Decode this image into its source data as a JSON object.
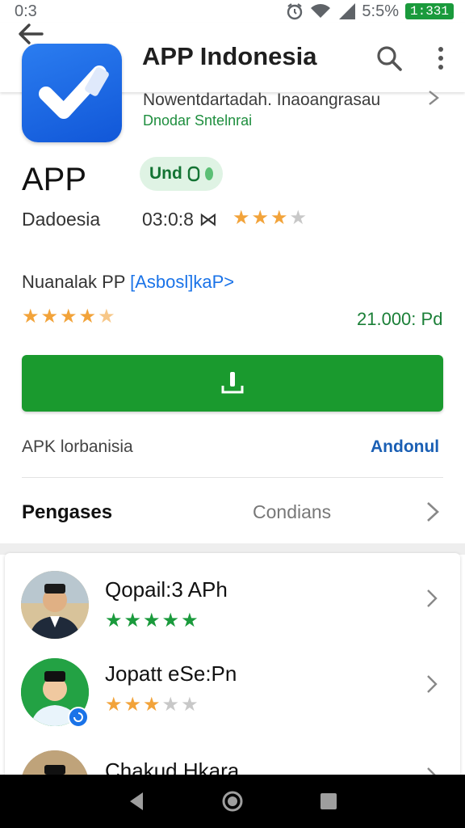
{
  "status_bar": {
    "time": "0:3",
    "battery_percent": "5:5%",
    "battery_badge": "1:331",
    "icons": [
      "alarm-icon",
      "wifi-icon",
      "signal-icon"
    ]
  },
  "header": {
    "title": "APP Indonesia",
    "back_icon": "back-arrow-icon",
    "search_icon": "search-icon",
    "more_icon": "more-vert-icon"
  },
  "app": {
    "developer_line": "Nowentdartadah. Inaoangrasau",
    "developer_sub": "Dnodar Sntelnrai",
    "name": "APP",
    "badge": "Und",
    "category": "Dadoesia",
    "meta_code": "03:0:8 ⋈",
    "meta_rating": 3,
    "about_text": "Nuanalak PP",
    "about_link": "[Asbosl]kaP>",
    "rating": 4.5,
    "price": "21.000: Pd",
    "apk_label": "APK lorbanisia",
    "apk_link": "Andonul"
  },
  "settings": {
    "title": "Pengases",
    "value": "Condians"
  },
  "related": [
    {
      "title": "Qopail:3 APh",
      "rating": 5,
      "star_color": "green"
    },
    {
      "title": "Jopatt eSe:Pn",
      "rating": 3,
      "star_color": "orange"
    },
    {
      "title": "Chakud Hkara",
      "rating": 0,
      "star_color": "orange"
    }
  ],
  "colors": {
    "accent_green": "#1a9a2e",
    "link_blue": "#1a73e8",
    "star_orange": "#f2a33a",
    "icon_blue": "#1a6ae6"
  },
  "nav": [
    "back-triangle-icon",
    "home-circle-icon",
    "recents-square-icon"
  ]
}
